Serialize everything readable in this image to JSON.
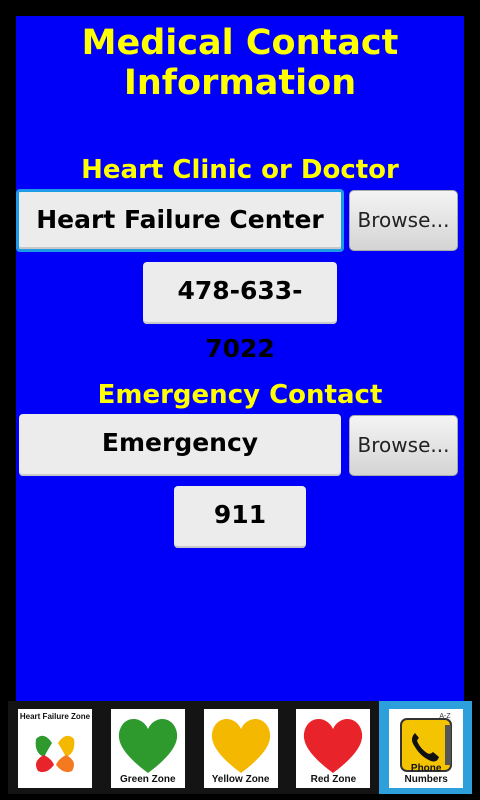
{
  "header": {
    "title_line1": "Medical Contact",
    "title_line2": "Information"
  },
  "clinic": {
    "heading": "Heart Clinic or Doctor",
    "name": "Heart Failure Center",
    "browse_label": "Browse...",
    "phone": "478-633-7022"
  },
  "emergency": {
    "heading": "Emergency Contact",
    "name": "Emergency",
    "browse_label": "Browse...",
    "phone": "911"
  },
  "tabs": [
    {
      "label": "Heart Failure Zone",
      "icon": "multicolor-hearts-icon"
    },
    {
      "label": "Green Zone",
      "icon": "green-heart-icon",
      "color": "#2e9a2e"
    },
    {
      "label": "Yellow Zone",
      "icon": "yellow-heart-icon",
      "color": "#f5b800"
    },
    {
      "label": "Red Zone",
      "icon": "red-heart-icon",
      "color": "#e8232a"
    },
    {
      "label": "Phone Numbers",
      "icon": "phone-book-icon",
      "badge": "A-Z",
      "selected": true
    }
  ],
  "colors": {
    "background": "#0000f8",
    "heading": "#ffff00",
    "focus": "#1e9be6",
    "selected_tab": "#2da0dc"
  }
}
